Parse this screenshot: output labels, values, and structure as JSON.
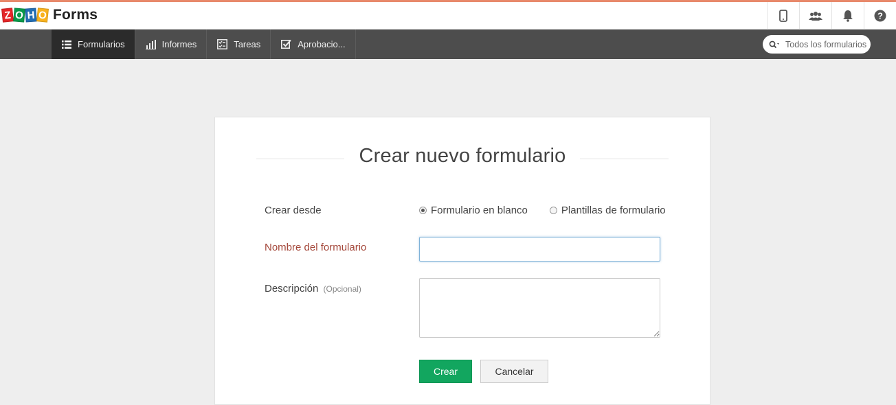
{
  "header": {
    "logo_letters": [
      "Z",
      "O",
      "H",
      "O"
    ],
    "app_name": "Forms",
    "icons": [
      "mobile-icon",
      "users-icon",
      "bell-icon",
      "help-icon"
    ]
  },
  "nav": {
    "items": [
      {
        "label": "Formularios",
        "icon": "list-icon",
        "active": true
      },
      {
        "label": "Informes",
        "icon": "bar-chart-icon",
        "active": false
      },
      {
        "label": "Tareas",
        "icon": "task-icon",
        "active": false
      },
      {
        "label": "Aprobacio...",
        "icon": "checkbox-icon",
        "active": false
      }
    ],
    "search": {
      "placeholder": "Todos los formularios",
      "value": ""
    }
  },
  "form": {
    "title": "Crear nuevo formulario",
    "create_from_label": "Crear desde",
    "options": [
      {
        "label": "Formulario en blanco",
        "selected": true
      },
      {
        "label": "Plantillas de formulario",
        "selected": false
      }
    ],
    "name_label": "Nombre del formulario",
    "name_value": "",
    "description_label": "Descripción",
    "description_optional": "(Opcional)",
    "description_value": "",
    "create_button": "Crear",
    "cancel_button": "Cancelar"
  },
  "colors": {
    "accent_bar": "#e8896b",
    "nav_bg": "#4d4d4d",
    "nav_active_bg": "#2b2b2b",
    "create_button": "#12a65f",
    "required_label": "#a4473a"
  }
}
